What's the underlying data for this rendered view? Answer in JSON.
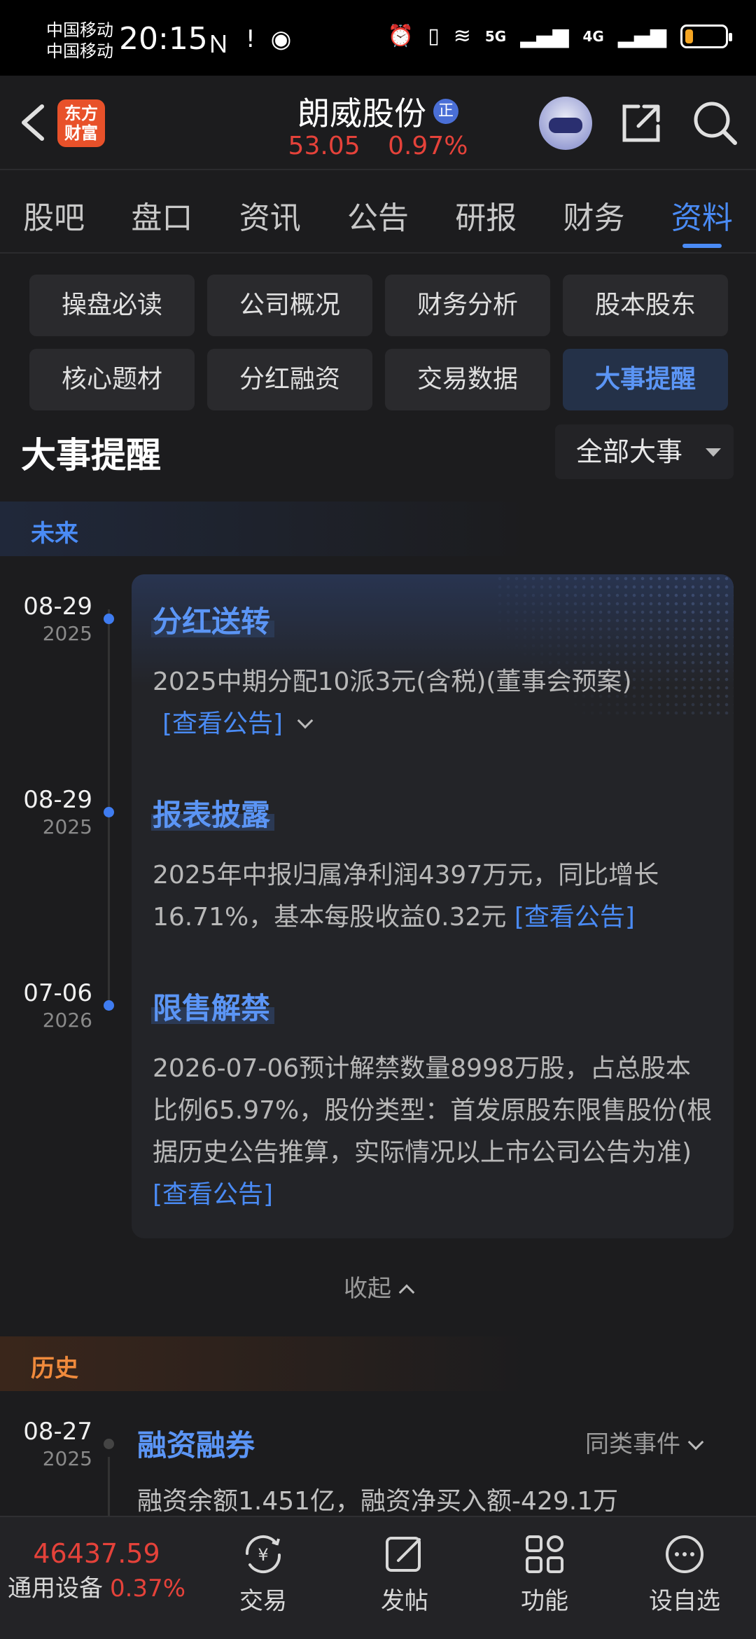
{
  "status_bar": {
    "carrier_1": "中国移动",
    "carrier_2": "中国移动",
    "time": "20:15",
    "net_1": "5G",
    "net_2": "4G",
    "battery_level": 0.2
  },
  "header": {
    "logo_line1": "东方",
    "logo_line2": "财富",
    "stock_name": "朗威股份",
    "badge": "正",
    "price": "53.05",
    "change_pct": "0.97%"
  },
  "tabs": [
    "股吧",
    "盘口",
    "资讯",
    "公告",
    "研报",
    "财务",
    "资料"
  ],
  "active_tab": "资料",
  "sub_menu": [
    "操盘必读",
    "公司概况",
    "财务分析",
    "股本股东",
    "核心题材",
    "分红融资",
    "交易数据",
    "大事提醒"
  ],
  "active_sub": "大事提醒",
  "section": {
    "title": "大事提醒",
    "filter": "全部大事"
  },
  "future": {
    "label": "未来",
    "events": [
      {
        "date": "08-29",
        "year": "2025",
        "title": "分红送转",
        "body": "2025中期分配10派3元(含税)(董事会预案)",
        "link": "[查看公告]"
      },
      {
        "date": "08-29",
        "year": "2025",
        "title": "报表披露",
        "body": "2025年中报归属净利润4397万元，同比增长16.71%，基本每股收益0.32元",
        "link": "[查看公告]"
      },
      {
        "date": "07-06",
        "year": "2026",
        "title": "限售解禁",
        "body": "2026-07-06预计解禁数量8998万股，占总股本比例65.97%，股份类型：首发原股东限售股份(根据历史公告推算，实际情况以上市公司公告为准)",
        "link": "[查看公告]"
      }
    ],
    "collapse_label": "收起"
  },
  "history": {
    "label": "历史",
    "events": [
      {
        "date": "08-27",
        "year": "2025",
        "title": "融资融券",
        "same_type": "同类事件",
        "body": "融资余额1.451亿，融资净买入额-429.1万"
      }
    ]
  },
  "bottom_bar": {
    "index_value": "46437.59",
    "index_name": "通用设备",
    "index_pct": "0.37%",
    "items": [
      {
        "label": "交易",
        "icon": "trade-icon"
      },
      {
        "label": "发帖",
        "icon": "post-icon"
      },
      {
        "label": "功能",
        "icon": "grid-icon"
      },
      {
        "label": "设自选",
        "icon": "more-icon"
      }
    ]
  }
}
